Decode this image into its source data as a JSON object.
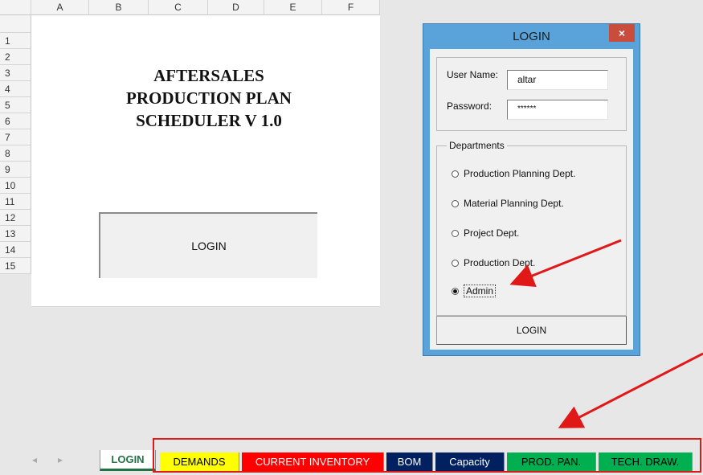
{
  "spreadsheet": {
    "columns": [
      "A",
      "B",
      "C",
      "D",
      "E",
      "F"
    ],
    "rows": [
      "1",
      "2",
      "3",
      "4",
      "5",
      "6",
      "7",
      "8",
      "9",
      "10",
      "11",
      "12",
      "13",
      "14",
      "15"
    ],
    "title_lines": [
      "AFTERSALES",
      "PRODUCTION PLAN",
      "SCHEDULER V 1.0"
    ],
    "login_button": "LOGIN"
  },
  "dialog": {
    "title": "LOGIN",
    "close": "×",
    "username_label": "User Name:",
    "username_value": "altar",
    "password_label": "Password:",
    "password_value": "******",
    "departments_legend": "Departments",
    "departments": [
      {
        "label": "Production Planning Dept.",
        "selected": false
      },
      {
        "label": "Material Planning Dept.",
        "selected": false
      },
      {
        "label": "Project Dept.",
        "selected": false
      },
      {
        "label": "Production Dept.",
        "selected": false
      },
      {
        "label": "Admin",
        "selected": true
      }
    ],
    "login_button": "LOGIN"
  },
  "tabs": [
    {
      "label": "LOGIN",
      "bg": "#ffffff",
      "color": "#217346",
      "active": true
    },
    {
      "label": "DEMANDS",
      "bg": "#ffff00",
      "color": "#000000"
    },
    {
      "label": "CURRENT INVENTORY",
      "bg": "#ff0000",
      "color": "#ffffff"
    },
    {
      "label": "BOM",
      "bg": "#002060",
      "color": "#ffffff"
    },
    {
      "label": "Capacity",
      "bg": "#002060",
      "color": "#ffffff"
    },
    {
      "label": "PROD. PAN.",
      "bg": "#00b050",
      "color": "#000000"
    },
    {
      "label": "TECH. DRAW.",
      "bg": "#00b050",
      "color": "#000000"
    }
  ],
  "annotation_color": "#e01818"
}
